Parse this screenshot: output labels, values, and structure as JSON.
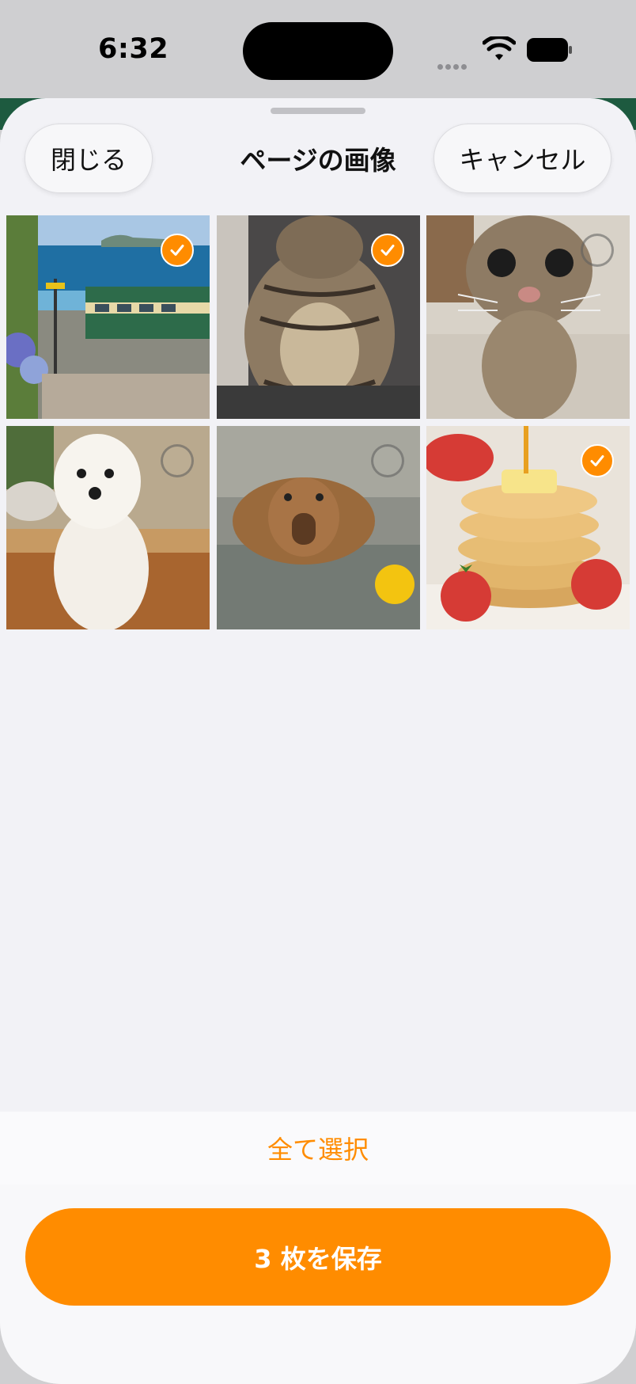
{
  "status": {
    "time": "6:32"
  },
  "header": {
    "close_label": "閉じる",
    "title": "ページの画像",
    "cancel_label": "キャンセル"
  },
  "images": [
    {
      "subject": "coastal-train",
      "selected": true
    },
    {
      "subject": "cat-sitting",
      "selected": true
    },
    {
      "subject": "cat-closeup",
      "selected": false
    },
    {
      "subject": "white-dog",
      "selected": false
    },
    {
      "subject": "capybara-hot-spring",
      "selected": false
    },
    {
      "subject": "pancakes-strawberries",
      "selected": true
    }
  ],
  "footer": {
    "select_all_label": "全て選択",
    "save_label": "3 枚を保存"
  },
  "colors": {
    "accent": "#ff8c00"
  }
}
